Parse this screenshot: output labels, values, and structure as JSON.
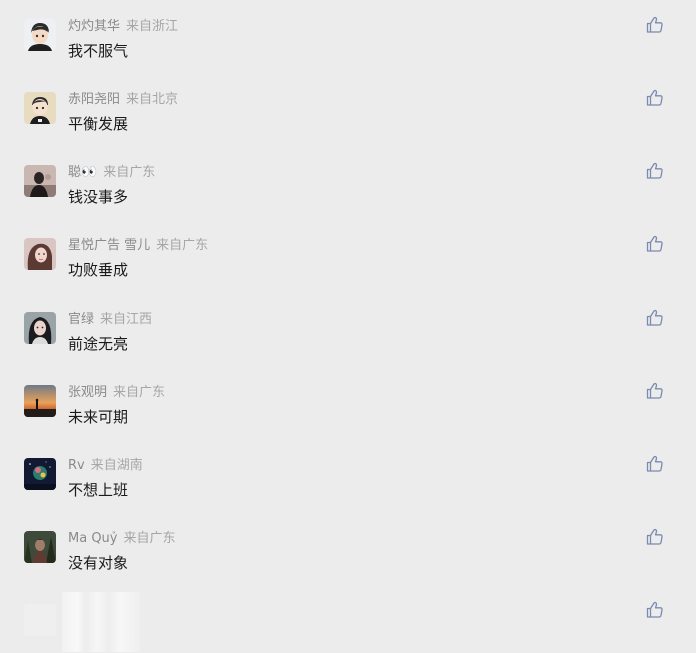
{
  "comments": [
    {
      "nickname": "灼灼其华",
      "location": "来自浙江",
      "text": "我不服气",
      "avatar": "avatar-cartoon-boy"
    },
    {
      "nickname": "赤阳尧阳",
      "location": "来自北京",
      "text": "平衡发展",
      "avatar": "avatar-cartoon-boy-beige"
    },
    {
      "nickname": "聪👀",
      "location": "来自广东",
      "text": "钱没事多",
      "avatar": "avatar-photo-person"
    },
    {
      "nickname": "星悦广告 雪儿",
      "location": "来自广东",
      "text": "功败垂成",
      "avatar": "avatar-photo-woman"
    },
    {
      "nickname": "官绿",
      "location": "来自江西",
      "text": "前途无亮",
      "avatar": "avatar-photo-girl"
    },
    {
      "nickname": "张观明",
      "location": "来自广东",
      "text": "未来可期",
      "avatar": "avatar-photo-sunset"
    },
    {
      "nickname": "Rv",
      "location": "来自湖南",
      "text": "不想上班",
      "avatar": "avatar-photo-night"
    },
    {
      "nickname": "Ma Quỷ",
      "location": "来自广东",
      "text": "没有对象",
      "avatar": "avatar-photo-forest"
    }
  ],
  "like_icon": "thumbs-up-icon",
  "colors": {
    "background": "#ececec",
    "nickname": "#8a8a8a",
    "content": "#1a1a1a",
    "like_icon": "#7a8ab0"
  }
}
